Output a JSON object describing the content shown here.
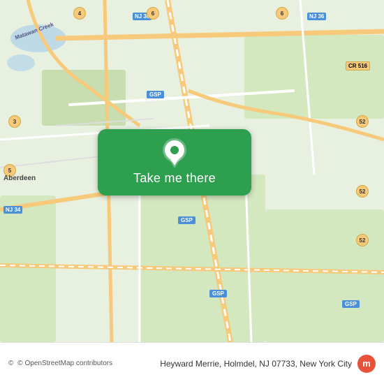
{
  "map": {
    "background_color": "#e8f0e0",
    "center_lat": 40.38,
    "center_lon": -74.19
  },
  "button": {
    "label": "Take me there",
    "background": "#2e9e4f"
  },
  "bottom_bar": {
    "copyright": "© OpenStreetMap contributors",
    "address": "Heyward Merrie, Holmdel, NJ 07733, New York City",
    "logo_text": "moovit"
  }
}
